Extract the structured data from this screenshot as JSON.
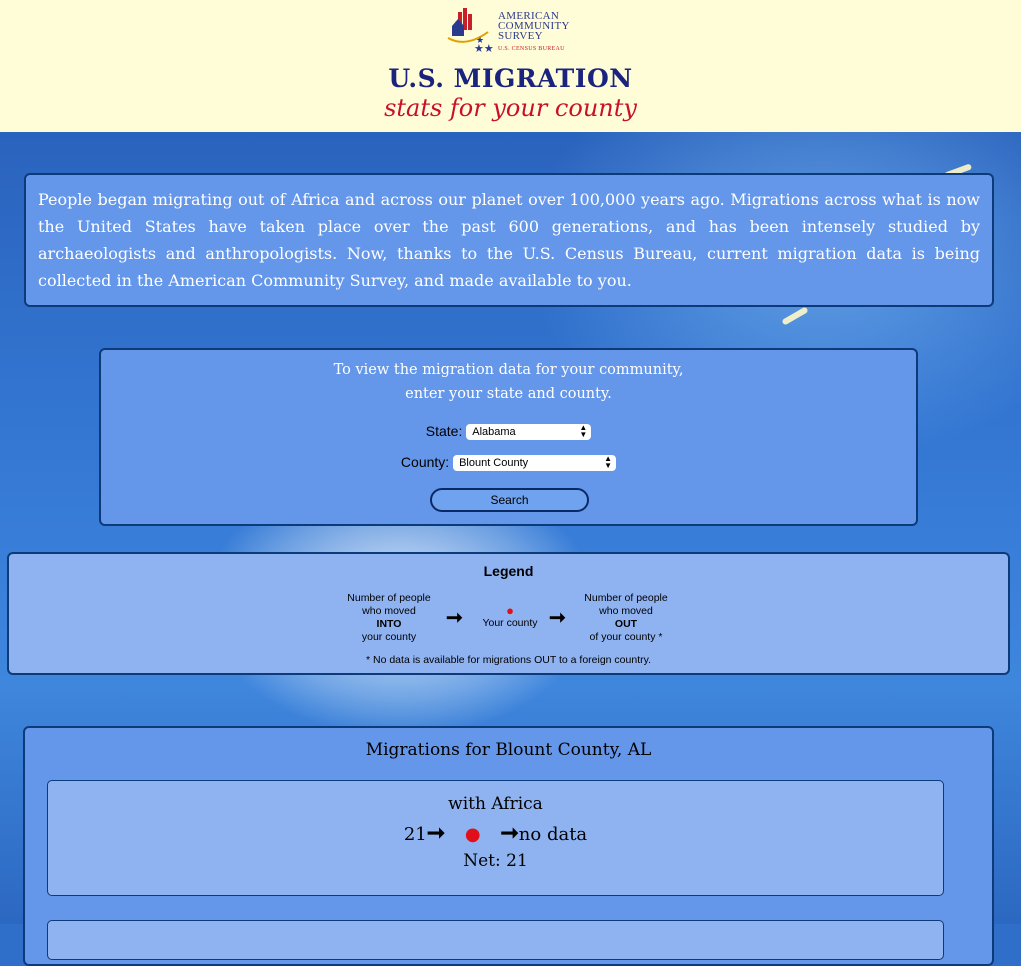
{
  "header": {
    "logo_lines": [
      "AMERICAN",
      "COMMUNITY",
      "SURVEY"
    ],
    "logo_sub": "U.S. CENSUS BUREAU",
    "title": "U.S. MIGRATION",
    "subtitle": "stats for your county"
  },
  "intro": {
    "text": "People began migrating out of Africa and across our planet over 100,000 years ago. Migrations across what is now the United States have taken place over the past 600 generations, and has been intensely studied by archaeologists and anthropologists. Now, thanks to the U.S. Census Bureau, current migration data is being collected in the American Community Survey, and made available to you."
  },
  "search": {
    "prompt_line1": "To view the migration data for your community,",
    "prompt_line2": "enter your state and county.",
    "state_label": "State:",
    "state_value": "Alabama",
    "county_label": "County:",
    "county_value": "Blount County",
    "button_label": "Search"
  },
  "legend": {
    "title": "Legend",
    "into_lines": [
      "Number of people",
      "who moved",
      "INTO",
      "your county"
    ],
    "county_label": "Your county",
    "out_lines": [
      "Number of people",
      "who moved",
      "OUT",
      "of your county *"
    ],
    "note": "* No data is available for migrations OUT to a foreign country."
  },
  "results": {
    "title": "Migrations for Blount County, AL",
    "cards": [
      {
        "with": "with Africa",
        "in": "21",
        "out": "no data",
        "net": "Net: 21"
      }
    ]
  },
  "colors": {
    "header_bg": "#fffcd8",
    "title": "#1a237e",
    "subtitle": "#c8102e",
    "panel": "#6496ea",
    "legend_panel": "#8fb2f1",
    "pin": "#e0101a"
  },
  "icons": [
    "map-pin-icon",
    "arrow-right-icon",
    "census-logo-icon"
  ]
}
